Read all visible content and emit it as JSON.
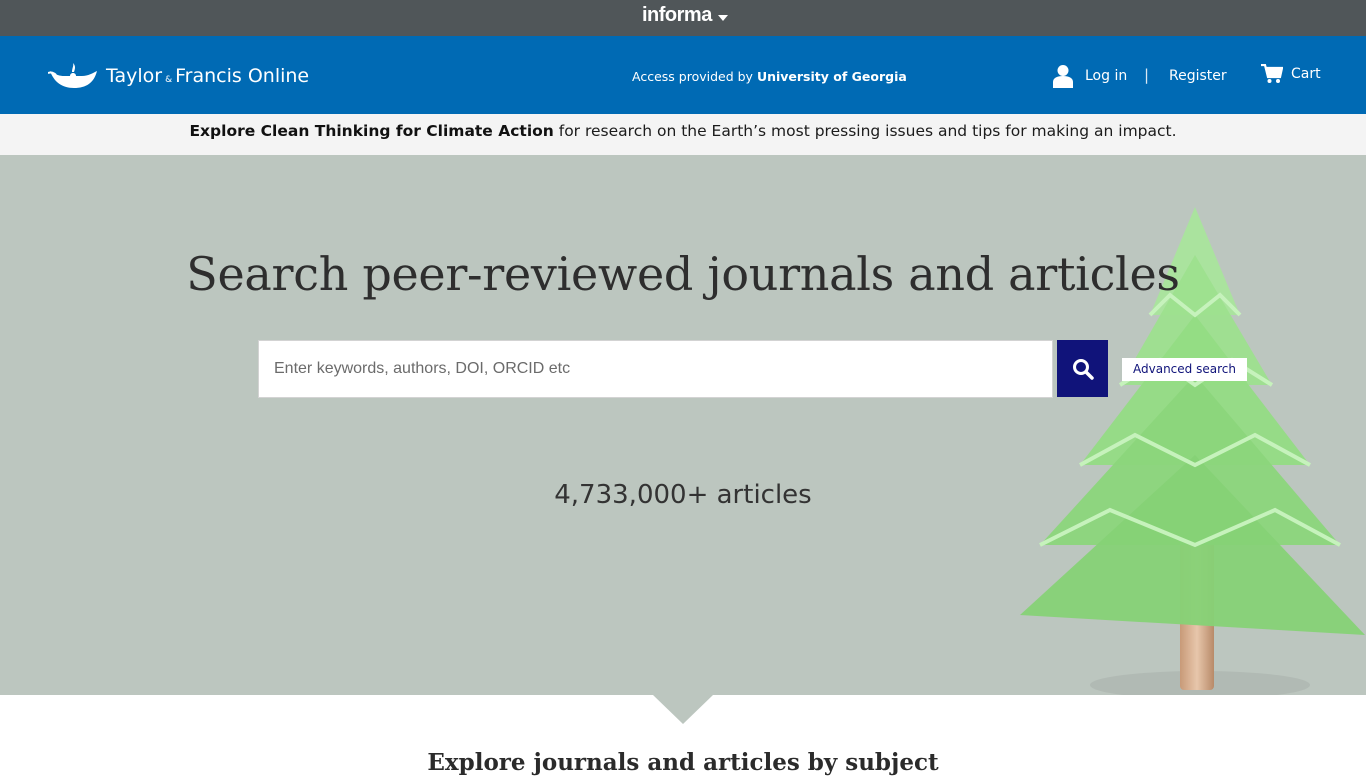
{
  "informa_bar": {
    "brand": "informa",
    "icon": "chevron-down-icon"
  },
  "header": {
    "logo_main": "Taylor",
    "logo_amp": "&",
    "logo_rest": "Francis Online",
    "access_prefix": "Access provided by",
    "access_institution": "University of Georgia",
    "login_label": "Log in",
    "separator": "|",
    "register_label": "Register",
    "cart_label": "Cart",
    "colors": {
      "header_bg": "#006ab4",
      "bar_bg": "#505659"
    }
  },
  "promo": {
    "link_text": "Explore Clean Thinking for Climate Action",
    "rest_text": " for research on the Earth’s most pressing issues and tips for making an impact."
  },
  "hero": {
    "title": "Search peer-reviewed journals and articles",
    "search_placeholder": "Enter keywords, authors, DOI, ORCID etc",
    "search_value": "",
    "advanced_search_label": "Advanced search",
    "article_count": "4,733,000+ articles",
    "colors": {
      "search_button_bg": "#10137a",
      "hero_bg": "#bcc6bf"
    }
  },
  "explore": {
    "heading": "Explore journals and articles by subject"
  }
}
